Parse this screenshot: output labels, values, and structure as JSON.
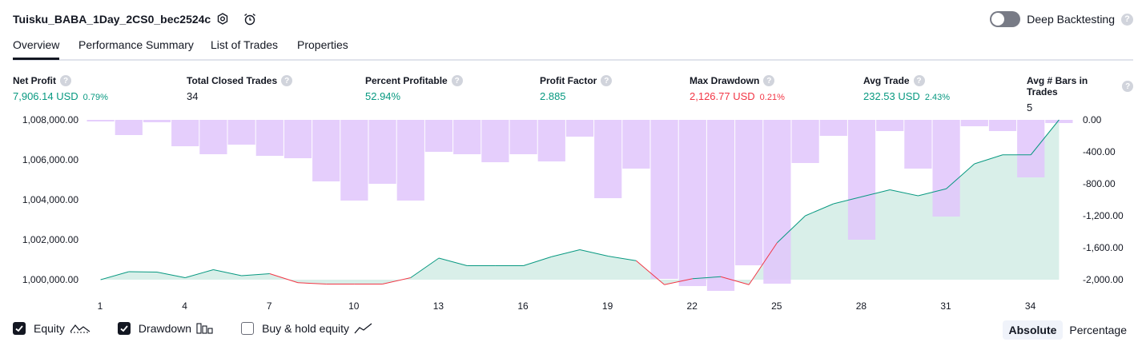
{
  "header": {
    "title": "Tuisku_BABA_1Day_2CS0_bec2524c",
    "deep_backtesting_label": "Deep Backtesting",
    "help_glyph": "?"
  },
  "tabs": [
    {
      "label": "Overview",
      "active": true
    },
    {
      "label": "Performance Summary",
      "active": false
    },
    {
      "label": "List of Trades",
      "active": false
    },
    {
      "label": "Properties",
      "active": false
    }
  ],
  "stats": [
    {
      "label": "Net Profit",
      "value": "7,906.14 USD",
      "pct": "0.79%",
      "color": "green"
    },
    {
      "label": "Total Closed Trades",
      "value": "34",
      "pct": "",
      "color": "dark"
    },
    {
      "label": "Percent Profitable",
      "value": "52.94%",
      "pct": "",
      "color": "green"
    },
    {
      "label": "Profit Factor",
      "value": "2.885",
      "pct": "",
      "color": "green"
    },
    {
      "label": "Max Drawdown",
      "value": "2,126.77 USD",
      "pct": "0.21%",
      "color": "red"
    },
    {
      "label": "Avg Trade",
      "value": "232.53 USD",
      "pct": "2.43%",
      "color": "green"
    },
    {
      "label": "Avg # Bars in Trades",
      "value": "5",
      "pct": "",
      "color": "dark"
    }
  ],
  "chart_data": {
    "type": "line",
    "x": [
      1,
      2,
      3,
      4,
      5,
      6,
      7,
      8,
      9,
      10,
      11,
      12,
      13,
      14,
      15,
      16,
      17,
      18,
      19,
      20,
      21,
      22,
      23,
      24,
      25,
      26,
      27,
      28,
      29,
      30,
      31,
      32,
      33,
      34,
      35
    ],
    "x_ticks": [
      "1",
      "4",
      "7",
      "10",
      "13",
      "16",
      "19",
      "22",
      "25",
      "28",
      "31",
      "34"
    ],
    "left_axis": {
      "ticks": [
        "1,008,000.00",
        "1,006,000.00",
        "1,004,000.00",
        "1,002,000.00",
        "1,000,000.00"
      ],
      "range": [
        999500,
        1008000
      ]
    },
    "right_axis": {
      "ticks": [
        "0.00",
        "-400.00",
        "-800.00",
        "-1,200.00",
        "-1,600.00",
        "-2,000.00"
      ],
      "range": [
        -2100,
        0
      ]
    },
    "series": [
      {
        "name": "Equity",
        "axis": "left",
        "values": [
          1000000,
          1000400,
          1000380,
          1000100,
          1000500,
          1000200,
          1000300,
          999850,
          999780,
          999780,
          999780,
          1000100,
          1001080,
          1000700,
          1000700,
          1000700,
          1001150,
          1001500,
          1001180,
          1000950,
          999750,
          1000050,
          1000150,
          999750,
          1001850,
          1003200,
          1003800,
          1004150,
          1004500,
          1004200,
          1004550,
          1005800,
          1006250,
          1006250,
          1008000
        ]
      },
      {
        "name": "Drawdown",
        "axis": "right",
        "values": [
          -10,
          -190,
          -30,
          -330,
          -430,
          -310,
          -450,
          -480,
          -770,
          -1010,
          -800,
          -1010,
          -400,
          -430,
          -530,
          -430,
          -520,
          -210,
          -980,
          -610,
          -1990,
          -2080,
          -2140,
          -1820,
          -2050,
          -540,
          -200,
          -1500,
          -140,
          -610,
          -1210,
          -80,
          -140,
          -720,
          -40
        ]
      },
      {
        "name": "Buy & hold equity",
        "axis": "left",
        "values": []
      }
    ]
  },
  "legend": {
    "equity": {
      "label": "Equity",
      "checked": true
    },
    "drawdown": {
      "label": "Drawdown",
      "checked": true
    },
    "buyhold": {
      "label": "Buy & hold equity",
      "checked": false
    }
  },
  "modes": {
    "absolute": "Absolute",
    "percentage": "Percentage",
    "active": "absolute"
  },
  "colors": {
    "equity_line": "#089981",
    "equity_fill": "#d5ede7",
    "equity_neg": "#f23645",
    "drawdown_bar": "#e1c6fb",
    "accent": "#131722"
  }
}
